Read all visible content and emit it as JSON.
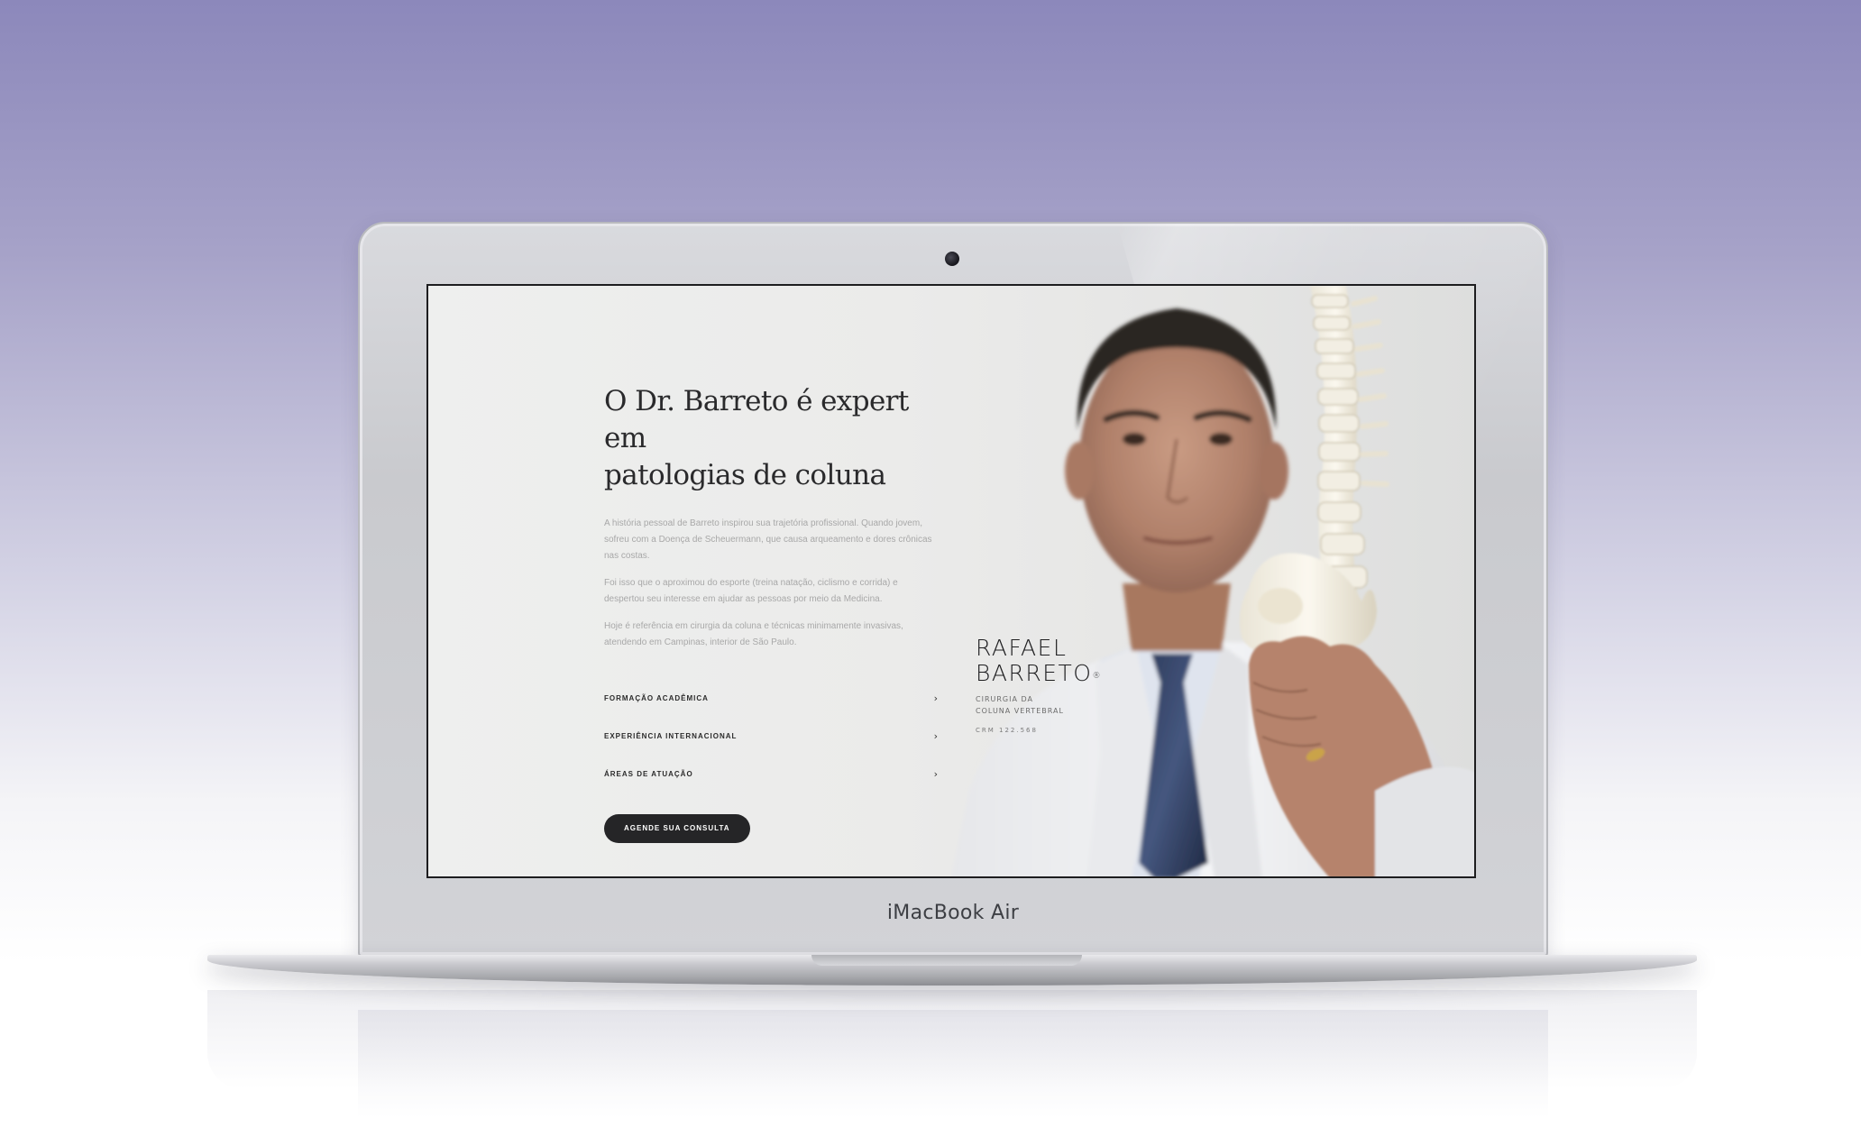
{
  "device": {
    "brand_label": "iMacBook Air"
  },
  "site": {
    "headline_line1": "O Dr. Barreto é expert em",
    "headline_line2": "patologias de coluna",
    "paragraphs": [
      "A história pessoal de Barreto inspirou sua trajetória profissional. Quando jovem, sofreu com a Doença de Scheuermann, que causa arqueamento e dores crônicas nas costas.",
      "Foi isso que o aproximou do esporte (treina natação, ciclismo e corrida) e despertou seu interesse em ajudar as pessoas por meio da Medicina.",
      "Hoje é referência em cirurgia da coluna e técnicas minimamente invasivas, atendendo em Campinas, interior de São Paulo."
    ],
    "accordion": [
      {
        "label": "FORMAÇÃO ACADÊMICA",
        "icon": "chevron-right-icon"
      },
      {
        "label": "EXPERIÊNCIA INTERNACIONAL",
        "icon": "chevron-right-icon"
      },
      {
        "label": "ÁREAS DE ATUAÇÃO",
        "icon": "chevron-right-icon"
      }
    ],
    "cta_label": "AGENDE SUA CONSULTA",
    "logo": {
      "name_line1": "RAFAEL",
      "name_line2": "BARRETO",
      "registered_mark": "®",
      "specialty_line1": "CIRURGIA DA",
      "specialty_line2": "COLUNA VERTEBRAL",
      "crm": "CRM 122.568"
    }
  },
  "colors": {
    "background_top": "#8c88bb",
    "screen_bg": "#ebebea",
    "cta_bg": "#252527",
    "headline": "#2a2a2c",
    "body_text": "#a8a8a8"
  }
}
